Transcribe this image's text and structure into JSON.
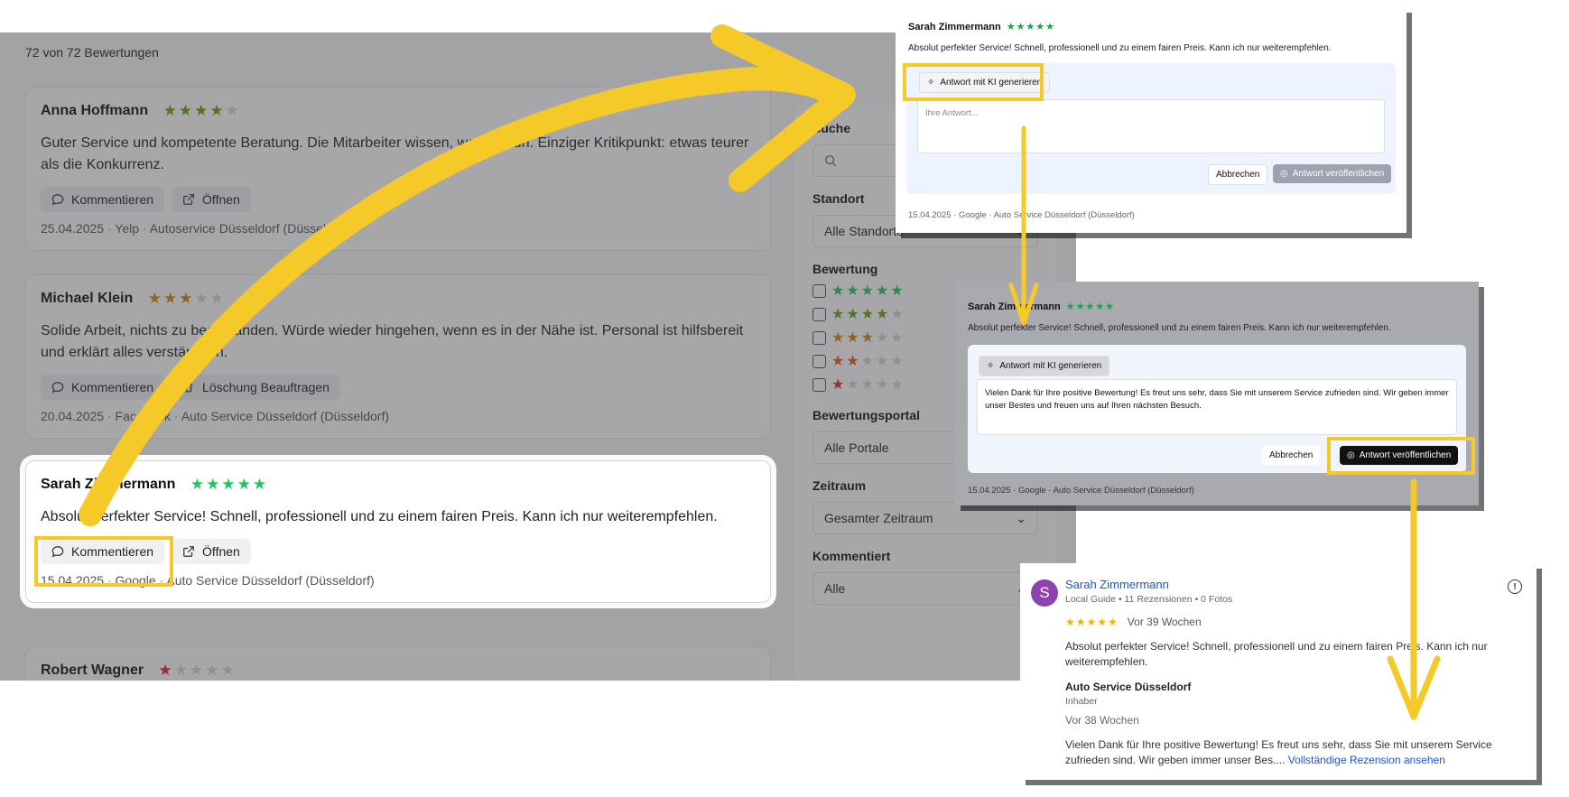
{
  "count_label": "72 von 72 Bewertungen",
  "colors": {
    "accent_yellow": "#f5c928",
    "star_green": "#22c55e",
    "star_lightgreen": "#65a30d",
    "star_amber": "#ca8a04",
    "star_red": "#dc2626",
    "star_empty": "#d4d4d8"
  },
  "reviews": [
    {
      "name": "Anna Hoffmann",
      "rating": 4,
      "text": "Guter Service und kompetente Beratung. Die Mitarbeiter wissen, was sie tun. Einziger Kritikpunkt: etwas teurer als die Konkurrenz.",
      "action1": "Kommentieren",
      "action2": "Öffnen",
      "date": "25.04.2025",
      "portal": "Yelp",
      "location": "Autoservice Düsseldorf (Düsseldorf)"
    },
    {
      "name": "Michael Klein",
      "rating": 3,
      "text": "Solide Arbeit, nichts zu beanstanden. Würde wieder hingehen, wenn es in der Nähe ist. Personal ist hilfsbereit und erklärt alles verständlich.",
      "action1": "Kommentieren",
      "action2": "Löschung Beauftragen",
      "date": "20.04.2025",
      "portal": "Facebook",
      "location": "Auto Service Düsseldorf (Düsseldorf)"
    },
    {
      "name": "Sarah Zimmermann",
      "rating": 5,
      "text": "Absolut perfekter Service! Schnell, professionell und zu einem fairen Preis. Kann ich nur weiterempfehlen.",
      "action1": "Kommentieren",
      "action2": "Öffnen",
      "date": "15.04.2025",
      "portal": "Google",
      "location": "Auto Service Düsseldorf (Düsseldorf)"
    },
    {
      "name": "Robert Wagner",
      "rating": 1
    }
  ],
  "filters": {
    "search_label": "Suche",
    "standort_label": "Standort",
    "standort_value": "Alle Standorte",
    "bewertung_label": "Bewertung",
    "portal_label": "Bewertungsportal",
    "portal_value": "Alle Portale",
    "zeitraum_label": "Zeitraum",
    "zeitraum_value": "Gesamter Zeitraum",
    "kommentiert_label": "Kommentiert",
    "kommentiert_value": "Alle"
  },
  "step1": {
    "name": "Sarah Zimmermann",
    "text": "Absolut perfekter Service! Schnell, professionell und zu einem fairen Preis. Kann ich nur weiterempfehlen.",
    "ki_button": "Antwort mit KI generieren",
    "placeholder": "Ihre Antwort...",
    "cancel": "Abbrechen",
    "publish": "Antwort veröffentlichen",
    "date": "15.04.2025",
    "portal": "Google",
    "location": "Auto Service Düsseldorf (Düsseldorf)"
  },
  "step2": {
    "name": "Sarah Zimmermann",
    "text": "Absolut perfekter Service! Schnell, professionell und zu einem fairen Preis. Kann ich nur weiterempfehlen.",
    "ki_button": "Antwort mit KI generieren",
    "reply": "Vielen Dank für Ihre positive Bewertung! Es freut uns sehr, dass Sie mit unserem Service zufrieden sind. Wir geben immer unser Bestes und freuen uns auf Ihren nächsten Besuch.",
    "cancel": "Abbrechen",
    "publish": "Antwort veröffentlichen",
    "date": "15.04.2025",
    "portal": "Google",
    "location": "Auto Service Düsseldorf (Düsseldorf)"
  },
  "google": {
    "avatar_letter": "S",
    "name": "Sarah Zimmermann",
    "sub": "Local Guide • 11 Rezensionen • 0 Fotos",
    "time": "Vor 39 Wochen",
    "text": "Absolut perfekter Service! Schnell, professionell und zu einem fairen Preis. Kann ich nur weiterempfehlen.",
    "owner": "Auto Service Düsseldorf",
    "owner_role": "Inhaber",
    "owner_time": "Vor 38 Wochen",
    "reply": "Vielen Dank für Ihre positive Bewertung! Es freut uns sehr, dass Sie mit unserem Service zufrieden sind. Wir geben immer unser Bes....",
    "more_link": "Vollständige Rezension ansehen"
  }
}
